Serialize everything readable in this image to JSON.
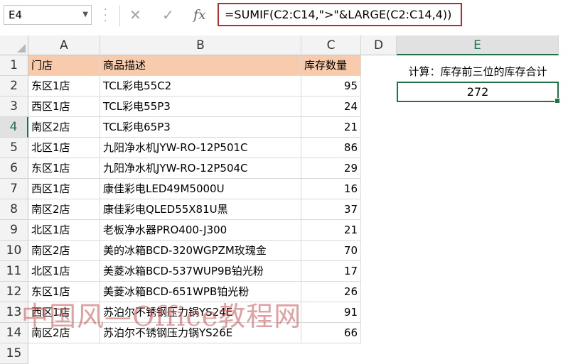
{
  "formula_bar": {
    "name_box": "E4",
    "cancel_icon": "✕",
    "confirm_icon": "✓",
    "fx_label": "fx",
    "formula": "=SUMIF(C2:C14,\">\"&LARGE(C2:C14,4))"
  },
  "columns": [
    "A",
    "B",
    "C",
    "D",
    "E"
  ],
  "rows": [
    "1",
    "2",
    "3",
    "4",
    "5",
    "6",
    "7",
    "8",
    "9",
    "10",
    "11",
    "12",
    "13",
    "14",
    "15"
  ],
  "table": {
    "headers": [
      "门店",
      "商品描述",
      "库存数量"
    ],
    "rows": [
      [
        "东区1店",
        "TCL彩电55C2",
        "95"
      ],
      [
        "西区1店",
        "TCL彩电55P3",
        "24"
      ],
      [
        "南区2店",
        "TCL彩电65P3",
        "21"
      ],
      [
        "北区1店",
        "九阳净水机JYW-RO-12P501C",
        "86"
      ],
      [
        "东区1店",
        "九阳净水机JYW-RO-12P504C",
        "29"
      ],
      [
        "西区1店",
        "康佳彩电LED49M5000U",
        "16"
      ],
      [
        "南区2店",
        "康佳彩电QLED55X81U黑",
        "37"
      ],
      [
        "北区1店",
        "老板净水器PRO400-J300",
        "21"
      ],
      [
        "南区2店",
        "美的冰箱BCD-320WGPZM玫瑰金",
        "70"
      ],
      [
        "北区1店",
        "美菱冰箱BCD-537WUP9B铂光粉",
        "17"
      ],
      [
        "东区1店",
        "美菱冰箱BCD-651WPB铂光粉",
        "26"
      ],
      [
        "西区1店",
        "苏泊尔不锈钢压力锅YS24E",
        "91"
      ],
      [
        "南区2店",
        "苏泊尔不锈钢压力锅YS26E",
        "66"
      ]
    ]
  },
  "side": {
    "calc_label": "计算：库存前三位的库存合计",
    "result": "272"
  },
  "watermark": "中国风—Office教程网",
  "colors": {
    "header_fill": "#f8cbad",
    "selection": "#217346",
    "formula_border": "#c0282a"
  }
}
